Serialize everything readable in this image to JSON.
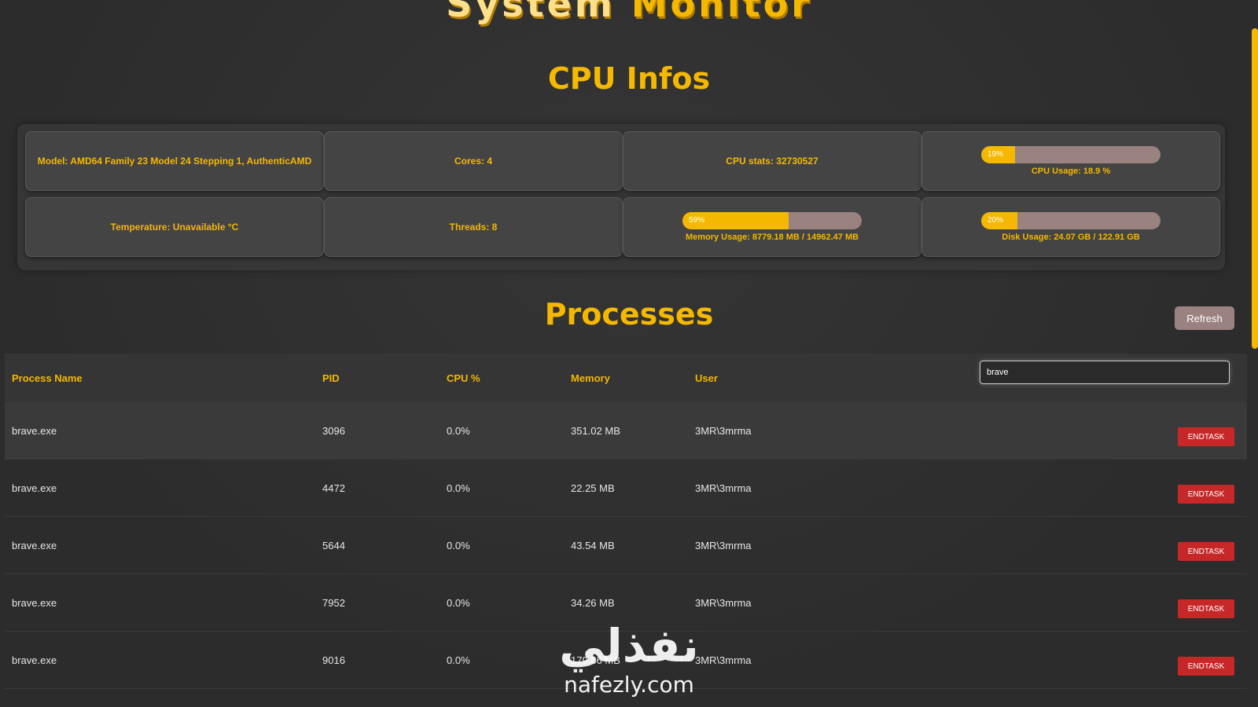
{
  "app": {
    "title_word1": "System",
    "title_word2": "Monitor"
  },
  "cpu": {
    "section_title": "CPU Infos",
    "model": "Model: AMD64 Family 23 Model 24 Stepping 1, AuthenticAMD",
    "cores": "Cores: 4",
    "stats": "CPU stats: 32730527",
    "cpu_usage": {
      "percent": 19,
      "percent_label": "19%",
      "label": "CPU Usage: 18.9 %"
    },
    "temperature": "Temperature: Unavailable °C",
    "threads": "Threads: 8",
    "memory_usage": {
      "percent": 59,
      "percent_label": "59%",
      "label": "Memory Usage: 8779.18 MB / 14962.47 MB"
    },
    "disk_usage": {
      "percent": 20,
      "percent_label": "20%",
      "label": "Disk Usage: 24.07 GB / 122.91 GB"
    }
  },
  "processes": {
    "section_title": "Processes",
    "refresh_label": "Refresh",
    "search_value": "brave",
    "columns": [
      "Process Name",
      "PID",
      "CPU %",
      "Memory",
      "User"
    ],
    "end_task_label": "ENDTASK",
    "rows": [
      {
        "name": "brave.exe",
        "pid": "3096",
        "cpu": "0.0%",
        "memory": "351.02 MB",
        "user": "3MR\\3mrma"
      },
      {
        "name": "brave.exe",
        "pid": "4472",
        "cpu": "0.0%",
        "memory": "22.25 MB",
        "user": "3MR\\3mrma"
      },
      {
        "name": "brave.exe",
        "pid": "5644",
        "cpu": "0.0%",
        "memory": "43.54 MB",
        "user": "3MR\\3mrma"
      },
      {
        "name": "brave.exe",
        "pid": "7952",
        "cpu": "0.0%",
        "memory": "34.26 MB",
        "user": "3MR\\3mrma"
      },
      {
        "name": "brave.exe",
        "pid": "9016",
        "cpu": "0.0%",
        "memory": "179.86 MB",
        "user": "3MR\\3mrma"
      }
    ]
  },
  "watermark": {
    "arabic": "نفذلي",
    "url": "nafezly.com"
  },
  "colors": {
    "accent": "#f5b800",
    "danger": "#c62828",
    "bar_track": "#9a8280",
    "background": "#2f2f2f"
  }
}
